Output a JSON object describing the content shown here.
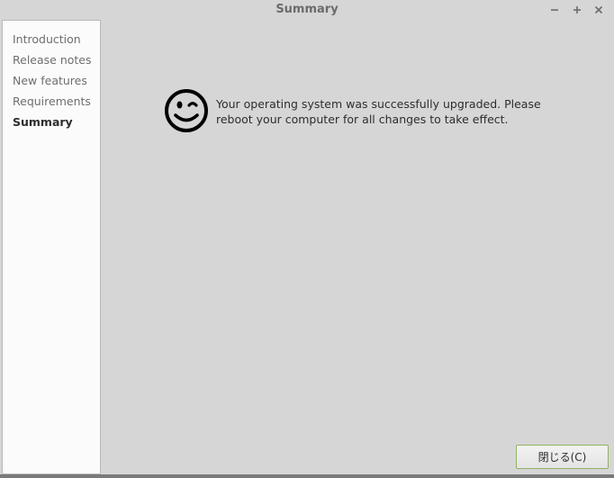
{
  "window": {
    "title": "Summary",
    "controls": {
      "minimize": "−",
      "maximize": "+",
      "close": "×"
    }
  },
  "sidebar": {
    "items": [
      {
        "label": "Introduction",
        "active": false
      },
      {
        "label": "Release notes",
        "active": false
      },
      {
        "label": "New features",
        "active": false
      },
      {
        "label": "Requirements",
        "active": false
      },
      {
        "label": "Summary",
        "active": true
      }
    ]
  },
  "main": {
    "icon": "wink-smiley-icon",
    "message": "Your operating system was successfully upgraded. Please reboot your computer for all changes to take effect."
  },
  "footer": {
    "close_label": "閉じる(C)"
  },
  "colors": {
    "background": "#d6d6d6",
    "sidebar_bg": "#fbfbfb",
    "button_border": "#8fb464",
    "text": "#2d2d2d"
  }
}
